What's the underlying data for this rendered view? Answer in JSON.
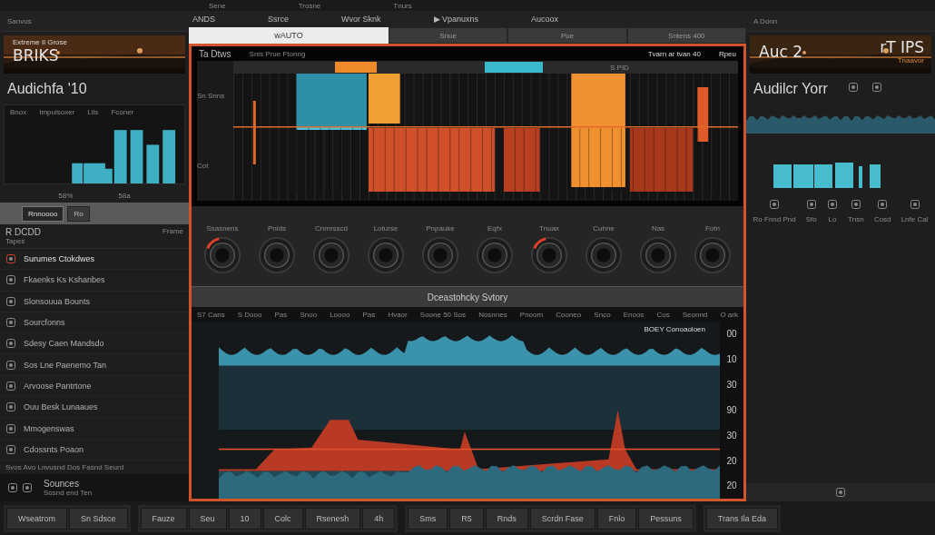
{
  "top_bar": {
    "items": [
      "Sene",
      "Trosne",
      "Tnurs"
    ]
  },
  "left_panel": {
    "header": "Sanvus",
    "banner": {
      "caption": "Extreme Il Grose",
      "title": "BRIKS"
    },
    "title": "Audichfa '10",
    "meter_labels": [
      "Bnox",
      "Impulsoxer",
      "Lils",
      "Fconer"
    ],
    "readouts": [
      "58%",
      "58a"
    ],
    "toolbar": [
      {
        "label": "Rnnoooo",
        "selected": true
      },
      {
        "label": "Ro",
        "selected": false
      }
    ],
    "list": {
      "header": "R DCDD",
      "subheader": "Tapes",
      "side_label": "Frame",
      "items": [
        {
          "label": "Surumes Ctokdwes",
          "selected": true
        },
        {
          "label": "Fkaenks Ks Kshanbes",
          "selected": false
        },
        {
          "label": "Slonsouua Bounts",
          "selected": false
        },
        {
          "label": "Sourcfonns",
          "selected": false
        },
        {
          "label": "Sdesy Caen Mandsdo",
          "selected": false
        },
        {
          "label": "Sos Lne Paenemo Tan",
          "selected": false
        },
        {
          "label": "Arvoose Pantrtone",
          "selected": false
        },
        {
          "label": "Ouu Besk Lunaaues",
          "selected": false
        },
        {
          "label": "Mmogenswas",
          "selected": false
        },
        {
          "label": "Cdossnts Poaon",
          "selected": false
        }
      ],
      "footer": "Svos Avo Lnvusnd Dos Fasnd Seurd"
    },
    "status": {
      "title": "Sounces",
      "subtitle": "Sosnd end Ten"
    }
  },
  "center_panel": {
    "tabs": [
      "ANDS",
      "Ssrce",
      "Wvor Sknk",
      "▶ Vpanuxns",
      "Aucoox"
    ],
    "field": {
      "value": "wAUTO"
    },
    "field_buttons": [
      "Snue",
      "Pue",
      "Sntens 400"
    ],
    "editor": {
      "title": "Ta Dtws",
      "subtitle": "Snis Prue Ftonng",
      "info": "Tvarn ar tvan 40",
      "menu": "Rpeu",
      "region_label": "S PID",
      "side_labels": [
        "Sn Snns",
        "Cot"
      ]
    },
    "knobs": [
      {
        "label": "Ssasnens",
        "active": true
      },
      {
        "label": "Pnlds",
        "active": false
      },
      {
        "label": "Cnmrsscd",
        "active": false
      },
      {
        "label": "Loturse",
        "active": false
      },
      {
        "label": "Pnpauke",
        "active": false
      },
      {
        "label": "Eqfx",
        "active": false
      },
      {
        "label": "Tnuax",
        "active": true
      },
      {
        "label": "Cuhne",
        "active": false
      },
      {
        "label": "Nas",
        "active": false
      },
      {
        "label": "Fotn",
        "active": false
      }
    ],
    "section_title": "Dceastohcky Svtory",
    "track_header": [
      "S7 Cans",
      "S Dooo",
      "Pas",
      "Snoo",
      "Loooo",
      "Pas",
      "Hvaor",
      "Soone 50 Sos",
      "Nosnnes",
      "Pnoom",
      "Cooneo",
      "Snco",
      "Enoos",
      "Cos",
      "Seonnd",
      "O ark"
    ],
    "track_title": "BOEY Conoaoloen",
    "scale": [
      "00",
      "10",
      "30",
      "90",
      "30",
      "20",
      "20"
    ]
  },
  "right_panel": {
    "header": "A Donn",
    "banner": {
      "title": "Auc 2",
      "tag": "rT IPS",
      "caption": "Tnaavor"
    },
    "title": "Audilcr Yorr",
    "icon_labels": [
      "Ro Fnnd Pnd",
      "Sfo",
      "Lo",
      "Tnsn",
      "Cosd",
      "Lnfe Cal"
    ]
  },
  "bottom_bar": {
    "groups": [
      [
        "Wseatrom",
        "Sn Sdsce"
      ],
      [
        "Fauze",
        "Seu",
        "10",
        "Colc",
        "Rsenesh",
        "4h"
      ],
      [
        "Sms",
        "R5",
        "Rnds",
        "Scrdn Fase",
        "Fnlo",
        "Pessuns"
      ],
      [
        "Trans Ila Eda"
      ]
    ]
  }
}
